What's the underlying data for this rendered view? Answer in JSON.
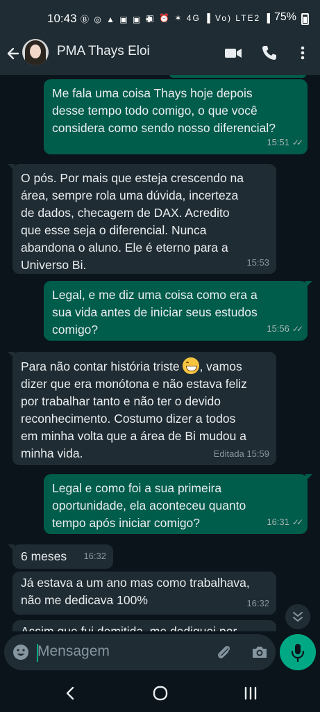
{
  "status_bar": {
    "time": "10:43",
    "left_icons": "Ⓑ ◎ ▲ ▣ ▣ ✤",
    "right_icons": "▣ ⏰ ✶ 4G ▐ Vo) LTE2 ▐",
    "battery": "75%"
  },
  "header": {
    "contact_name": "PMA Thays Eloi",
    "icons": [
      "back-arrow-icon",
      "video-call-icon",
      "phone-icon",
      "more-vert-icon"
    ]
  },
  "messages": [
    {
      "direction": "out",
      "text": "Me fala uma coisa Thays hoje depois\ndesse tempo todo comigo, o que você\nconsidera como sendo nosso diferencial?",
      "time": "15:51",
      "ticks": "✓✓"
    },
    {
      "direction": "in",
      "text": "O pós. Por mais que esteja crescendo na\nárea, sempre rola uma dúvida, incerteza\nde dados, checagem de DAX. Acredito\nque esse seja o diferencial. Nunca\nabandona o aluno. Ele é eterno para a\nUniverso Bi.",
      "time": "15:53"
    },
    {
      "direction": "out",
      "text": "Legal, e me diz uma coisa como era a\nsua vida antes de iniciar seus estudos\ncomigo?",
      "time": "15:56",
      "ticks": "✓✓"
    },
    {
      "direction": "in",
      "text_before_emoji": "Para não contar história triste ",
      "emoji": "grinning-sweat-emoji",
      "text_after_emoji": ", vamos",
      "text_rest": "dizer que era monótona e não estava feliz\npor trabalhar tanto e não ter o devido\nreconhecimento. Costumo dizer a todos\nem minha volta que a área de Bi mudou a\nminha vida.",
      "edited_label": "Editada",
      "time": "15:59"
    },
    {
      "direction": "out",
      "text": "Legal e como foi a sua primeira\noportunidade, ela aconteceu quanto\ntempo após iniciar comigo?",
      "time": "16:31",
      "ticks": "✓✓"
    },
    {
      "direction": "in",
      "text": "6 meses",
      "time": "16:32"
    },
    {
      "direction": "in",
      "text": "Já estava a um ano mas como trabalhava,\nnão me dedicava 100%",
      "time": "16:32"
    },
    {
      "direction": "in",
      "text": "Assim que fui demitida, me dediquei por",
      "time": ""
    }
  ],
  "input": {
    "placeholder": "Mensagem",
    "icons": [
      "emoji-icon",
      "attach-icon",
      "camera-icon",
      "mic-icon"
    ]
  },
  "nav": {
    "icons": [
      "back-nav-icon",
      "home-nav-icon",
      "recents-nav-icon"
    ]
  },
  "colors": {
    "outgoing_bubble": "#005c4b",
    "incoming_bubble": "#202c33",
    "background": "#0b141a",
    "header": "#1f2c33",
    "accent": "#00a884"
  }
}
